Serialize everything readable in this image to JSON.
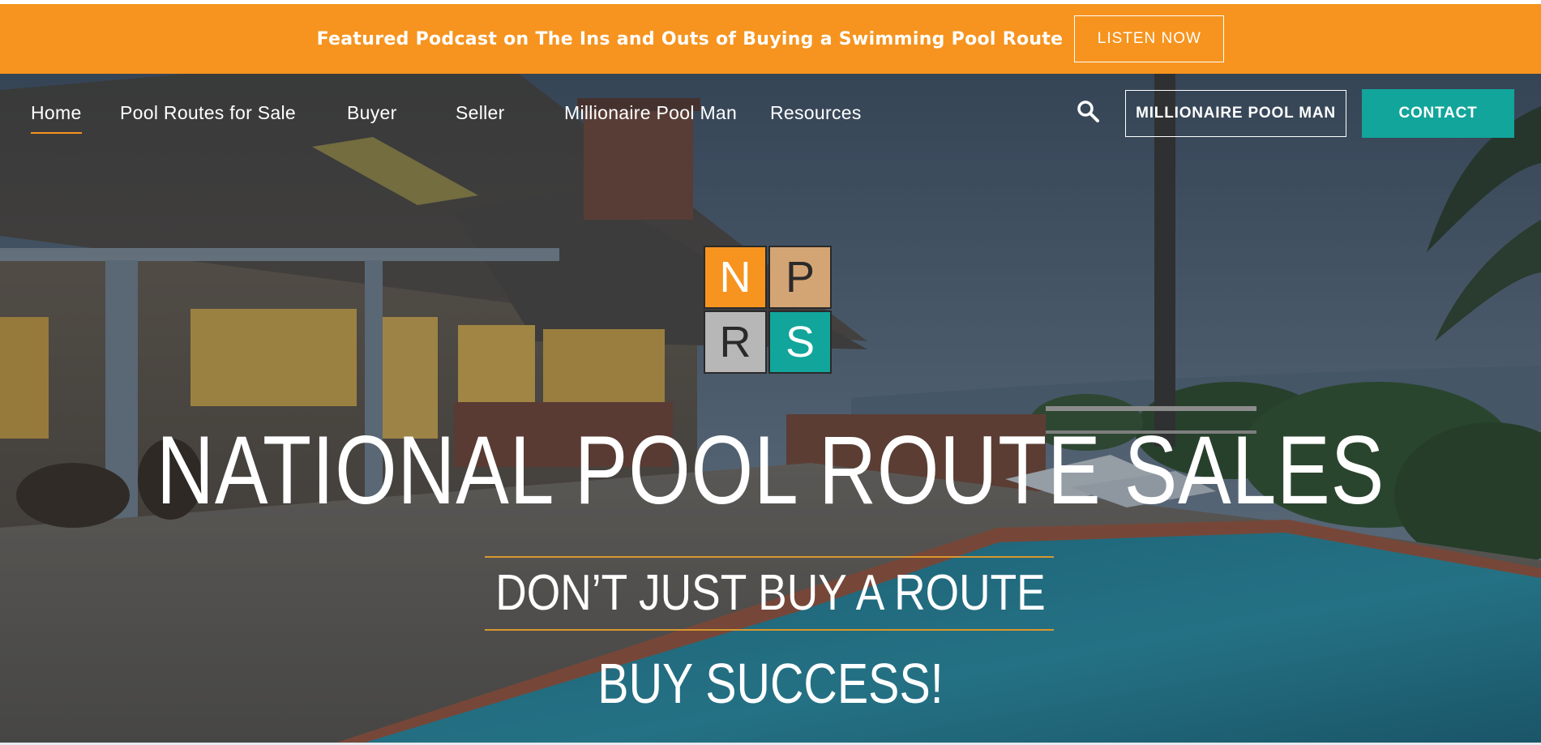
{
  "promo": {
    "text": "Featured Podcast on The Ins and Outs of Buying a Swimming Pool Route",
    "button_label": "LISTEN NOW"
  },
  "nav": {
    "items": [
      {
        "label": "Home",
        "active": true
      },
      {
        "label": "Pool Routes for Sale",
        "active": false
      },
      {
        "label": "Buyer",
        "active": false
      },
      {
        "label": "Seller",
        "active": false
      },
      {
        "label": "Millionaire Pool Man",
        "active": false
      },
      {
        "label": "Resources",
        "active": false
      }
    ],
    "search_icon": "search-icon",
    "secondary_button": "MILLIONAIRE POOL MAN",
    "contact_button": "CONTACT"
  },
  "logo": {
    "letters": [
      "N",
      "P",
      "R",
      "S"
    ]
  },
  "hero": {
    "title": "NATIONAL POOL ROUTE SALES",
    "tagline_1": "DON’T JUST BUY A ROUTE",
    "tagline_2": "BUY SUCCESS!"
  },
  "colors": {
    "brand_orange": "#f6941f",
    "brand_teal": "#12a59b",
    "logo_tan": "#d4a574",
    "logo_gray": "#b7b7b7"
  }
}
